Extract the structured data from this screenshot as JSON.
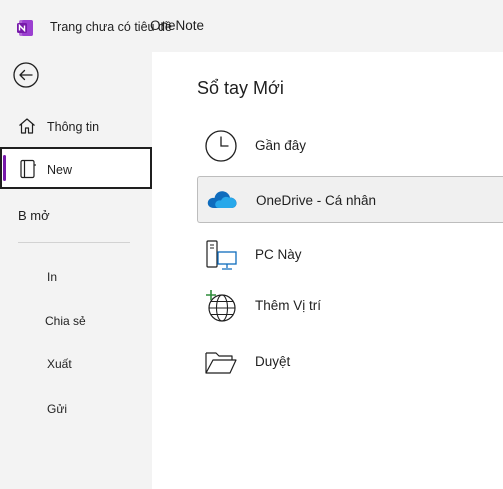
{
  "titlebar": {
    "document_title": "Trang chưa có tiêu đề",
    "app_name": "OneNote"
  },
  "sidebar": {
    "items": [
      {
        "label": "Thông tin"
      },
      {
        "label": "New"
      },
      {
        "label": "B mở"
      }
    ],
    "sub_items": [
      {
        "label": "In"
      },
      {
        "label": "Chia sẻ"
      },
      {
        "label": "Xuất"
      },
      {
        "label": "Gửi"
      }
    ]
  },
  "main": {
    "title": "Sổ tay Mới",
    "locations": [
      {
        "label": "Gần đây",
        "icon": "clock-icon"
      },
      {
        "label": "OneDrive - Cá nhân",
        "icon": "onedrive-cloud-icon"
      },
      {
        "label": "PC Này",
        "icon": "this-pc-icon"
      },
      {
        "label": "Thêm Vị trí",
        "icon": "add-place-globe-icon"
      },
      {
        "label": "Duyệt",
        "icon": "folder-open-icon"
      }
    ]
  },
  "colors": {
    "accent": "#7719aa",
    "onedrive_blue": "#0f6cbd",
    "sidebar_bg": "#f3f3f3",
    "selected_bg": "#f0f0f0"
  }
}
